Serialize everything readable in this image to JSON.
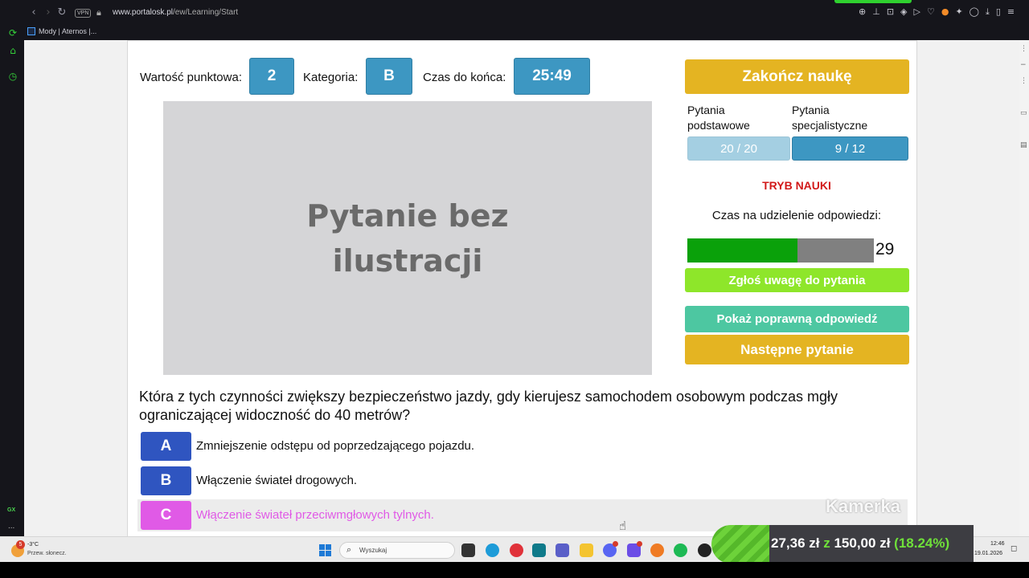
{
  "browser": {
    "url_host": "www.portalosk.pl",
    "url_path": "/ew/Learning/Start",
    "vpn_label": "VPN",
    "bookmark": "Mody | Aternos |..."
  },
  "sidebar": {
    "gx_label": "GX",
    "more_label": "..."
  },
  "header": {
    "points_label": "Wartość punktowa:",
    "points_value": "2",
    "category_label": "Kategoria:",
    "category_value": "B",
    "time_label": "Czas do końca:",
    "time_value": "25:49"
  },
  "illustration": {
    "text": "Pytanie bez ilustracji"
  },
  "right_panel": {
    "end_button": "Zakończ naukę",
    "basic_label": "Pytania podstawowe",
    "basic_count": "20 / 20",
    "special_label": "Pytania specjalistyczne",
    "special_count": "9 / 12",
    "mode": "TRYB NAUKI",
    "answer_time_label": "Czas na udzielenie odpowiedzi:",
    "answer_time_value": "29",
    "answer_time_fraction": 0.59,
    "report_button": "Zgłoś uwagę do pytania",
    "show_answer_button": "Pokaż poprawną odpowiedź",
    "next_button": "Następne pytanie"
  },
  "question": {
    "text": "Która z tych czynności zwiększy bezpieczeństwo jazdy, gdy kierujesz samochodem osobowym podczas mgły ograniczającej widoczność do 40 metrów?",
    "answers": [
      {
        "letter": "A",
        "text": "Zmniejszenie odstępu od poprzedzającego pojazdu."
      },
      {
        "letter": "B",
        "text": "Włączenie świateł drogowych."
      },
      {
        "letter": "C",
        "text": "Włączenie świateł przeciwmgłowych tylnych."
      }
    ],
    "selected": "C"
  },
  "overlay": {
    "camera_label": "Kamerka",
    "donation_current": "27,36 zł",
    "donation_of": "z",
    "donation_goal": "150,00 zł",
    "donation_percent": "(18.24%)"
  },
  "taskbar": {
    "weather_badge": "5",
    "weather_temp": "-3°C",
    "weather_desc": "Przew. słonecz.",
    "search_placeholder": "Wyszukaj",
    "time": "12:46",
    "date": "19.01.2026"
  },
  "colors": {
    "accent_blue": "#3d97c2",
    "gold": "#e4b422",
    "lime": "#8ee62a",
    "teal": "#4dc7a1",
    "answer_blue": "#2f55c0",
    "selected_magenta": "#e05ae6",
    "timer_green": "#0aa10a"
  }
}
